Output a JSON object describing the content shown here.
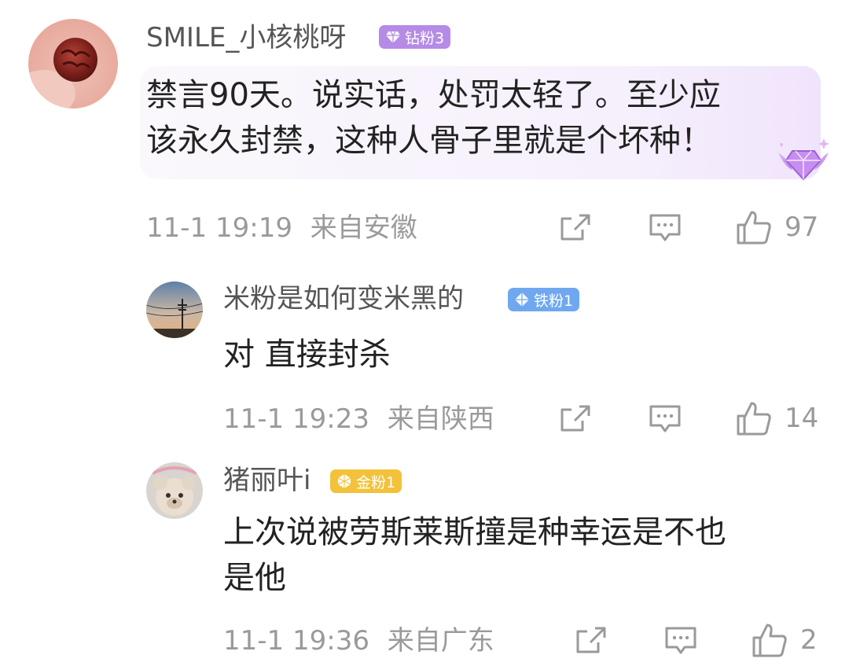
{
  "comments": [
    {
      "username": "SMILE_小核桃呀",
      "badge": {
        "label": "钻粉3",
        "color": "#b58be6"
      },
      "content_lines": [
        "禁言90天。说实话，处罚太轻了。至少应",
        "该永久封禁，这种人骨子里就是个坏种！"
      ],
      "timestamp": "11-1 19:19",
      "location": "来自安徽",
      "likes": "97"
    }
  ],
  "replies": [
    {
      "username": "米粉是如何变米黑的",
      "badge": {
        "label": "铁粉1",
        "color": "#6fa8ef"
      },
      "content_lines": [
        "对 直接封杀"
      ],
      "timestamp": "11-1 19:23",
      "location": "来自陕西",
      "likes": "14"
    },
    {
      "username": "猪丽叶i",
      "badge": {
        "label": "金粉1",
        "color": "#f3c23a"
      },
      "content_lines": [
        "上次说被劳斯莱斯撞是种幸运是不也",
        "是他"
      ],
      "timestamp": "11-1 19:36",
      "location": "来自广东",
      "likes": "2"
    }
  ],
  "icons": {
    "share": "share-icon",
    "comment": "comment-icon",
    "like": "thumbs-up-icon"
  }
}
